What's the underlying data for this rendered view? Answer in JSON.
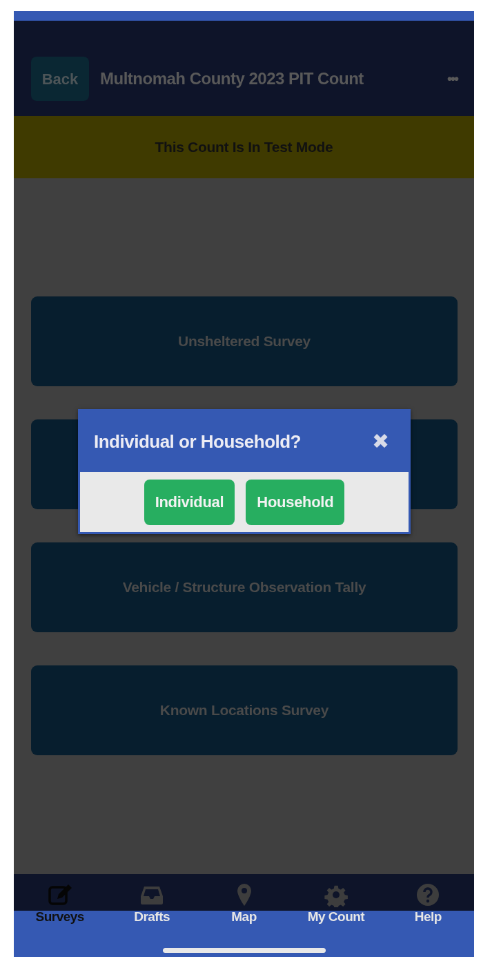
{
  "header": {
    "back_label": "Back",
    "title": "Multnomah County 2023 PIT Count",
    "menu_label": "•••"
  },
  "banner": {
    "text": "This Count Is In Test Mode"
  },
  "surveys": [
    {
      "kind": "labeled",
      "label": "Unsheltered Survey"
    },
    {
      "kind": "covered"
    },
    {
      "kind": "labeled",
      "label": "Vehicle / Structure Observation Tally"
    },
    {
      "kind": "labeled",
      "label": "Known Locations Survey"
    }
  ],
  "dialog": {
    "title": "Individual or Household?",
    "close_label": "✖",
    "buttons": [
      "Individual",
      "Household"
    ]
  },
  "tabs": [
    {
      "label": "Surveys",
      "kind": "edit",
      "selected": true
    },
    {
      "label": "Drafts",
      "kind": "inbox",
      "selected": false
    },
    {
      "label": "Map",
      "kind": "pin",
      "selected": false
    },
    {
      "label": "My Count",
      "kind": "gear",
      "selected": false
    },
    {
      "label": "Help",
      "kind": "help",
      "selected": false
    }
  ]
}
